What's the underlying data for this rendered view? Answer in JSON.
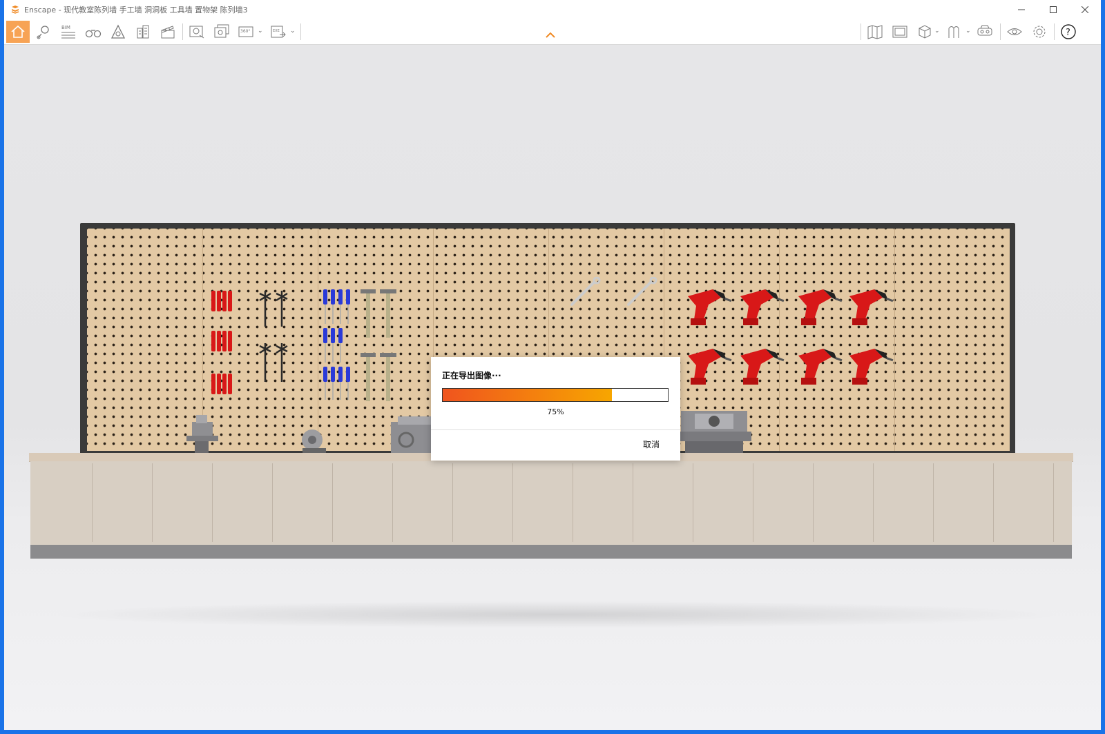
{
  "window": {
    "title": "Enscape - 现代教室陈列墙 手工墙 洞洞板 工具墙 置物架 陈列墙3",
    "controls": [
      "minimize",
      "maximize",
      "close"
    ]
  },
  "toolbar": {
    "left_tools": [
      {
        "name": "home",
        "icon": "home-icon",
        "active": true
      },
      {
        "name": "location",
        "icon": "map-pin-icon"
      },
      {
        "name": "bim",
        "icon": "bim-icon",
        "label": "BIM"
      },
      {
        "name": "views",
        "icon": "binoculars-icon"
      },
      {
        "name": "assets",
        "icon": "asset-library-icon"
      },
      {
        "name": "buildings",
        "icon": "buildings-icon"
      },
      {
        "name": "video",
        "icon": "clapperboard-icon"
      },
      {
        "name": "screenshot",
        "icon": "screenshot-icon"
      },
      {
        "name": "batch-render",
        "icon": "batch-render-icon"
      },
      {
        "name": "panorama",
        "icon": "panorama-icon",
        "label": "360°"
      },
      {
        "name": "export",
        "icon": "export-exe-icon",
        "label": "EXE"
      }
    ],
    "right_tools": [
      {
        "name": "map",
        "icon": "map-icon"
      },
      {
        "name": "capture-panel",
        "icon": "panel-icon"
      },
      {
        "name": "cube-view",
        "icon": "cube-icon"
      },
      {
        "name": "material",
        "icon": "material-icon"
      },
      {
        "name": "vr",
        "icon": "vr-headset-icon"
      },
      {
        "name": "view",
        "icon": "eye-icon"
      },
      {
        "name": "settings",
        "icon": "gear-icon"
      },
      {
        "name": "help",
        "icon": "help-icon"
      }
    ],
    "accent_color": "#f7a355"
  },
  "dialog": {
    "title": "正在导出图像···",
    "progress": 0.75,
    "progress_text": "75%",
    "cancel_label": "取消"
  },
  "colors": {
    "pegboard": "#e3c9a4",
    "drill_red": "#d81818",
    "screwdriver_blue": "#2a3ad8"
  }
}
